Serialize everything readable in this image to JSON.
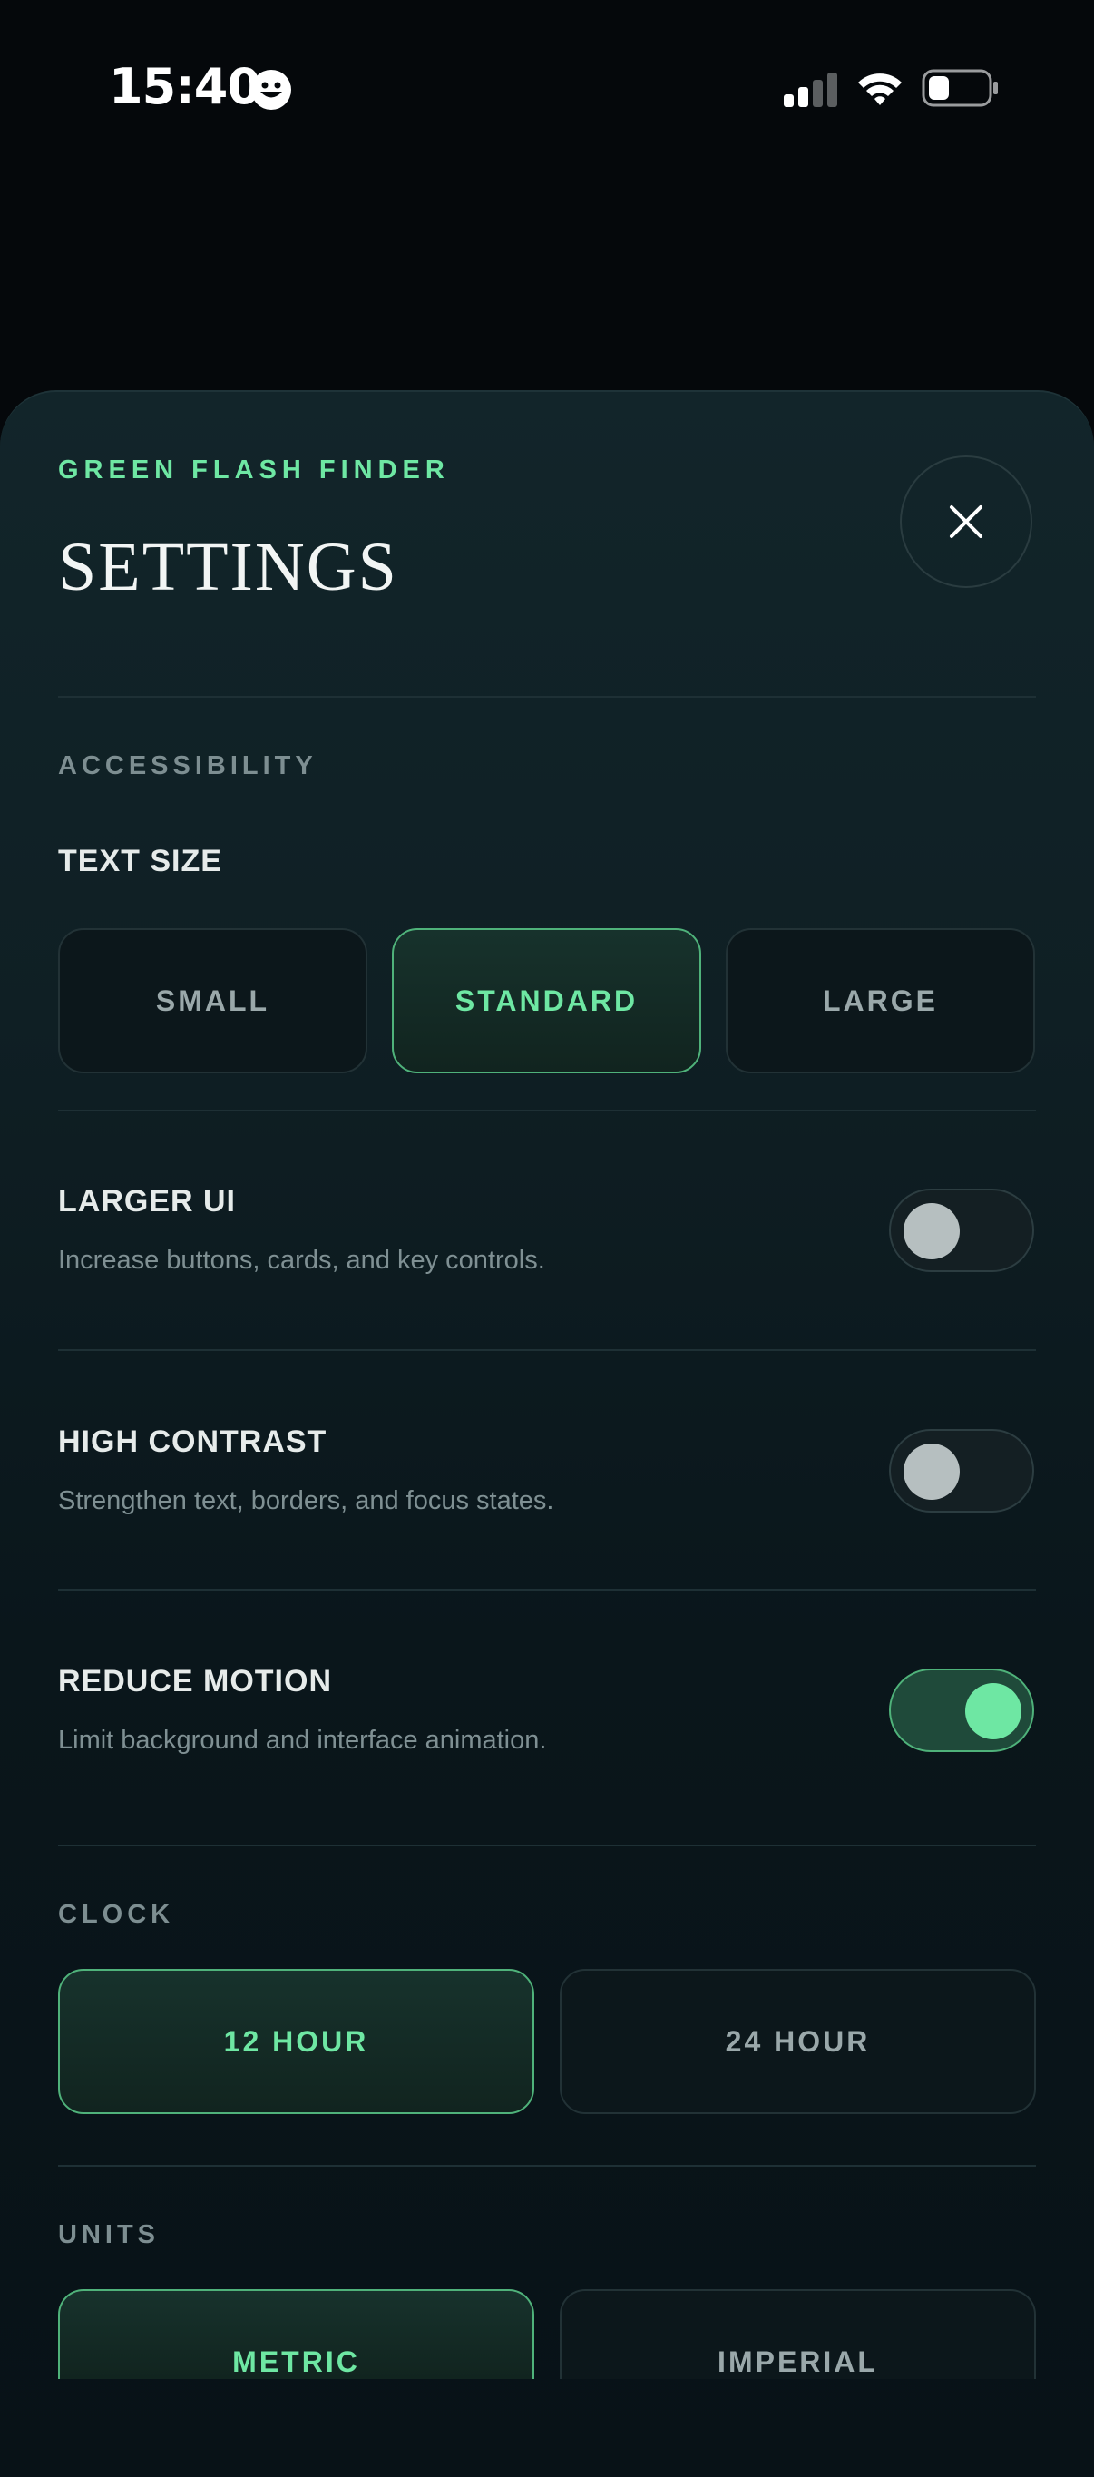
{
  "status_bar": {
    "time": "15:40"
  },
  "header": {
    "brand": "GREEN FLASH FINDER",
    "title": "SETTINGS",
    "close_icon": "close-icon"
  },
  "accessibility": {
    "section_label": "ACCESSIBILITY",
    "text_size": {
      "label": "TEXT SIZE",
      "options": [
        "SMALL",
        "STANDARD",
        "LARGE"
      ],
      "selected": "STANDARD"
    },
    "larger_ui": {
      "label": "LARGER UI",
      "description": "Increase buttons, cards, and key controls.",
      "enabled": false
    },
    "high_contrast": {
      "label": "HIGH CONTRAST",
      "description": "Strengthen text, borders, and focus states.",
      "enabled": false
    },
    "reduce_motion": {
      "label": "REDUCE MOTION",
      "description": "Limit background and interface animation.",
      "enabled": true
    }
  },
  "clock": {
    "section_label": "CLOCK",
    "options": [
      "12 HOUR",
      "24 HOUR"
    ],
    "selected": "12 HOUR"
  },
  "units": {
    "section_label": "UNITS",
    "options": [
      "METRIC",
      "IMPERIAL"
    ],
    "selected": "METRIC"
  },
  "colors": {
    "accent": "#6ee7a3",
    "background": "#05080b",
    "sheet": "#0f1f24"
  }
}
